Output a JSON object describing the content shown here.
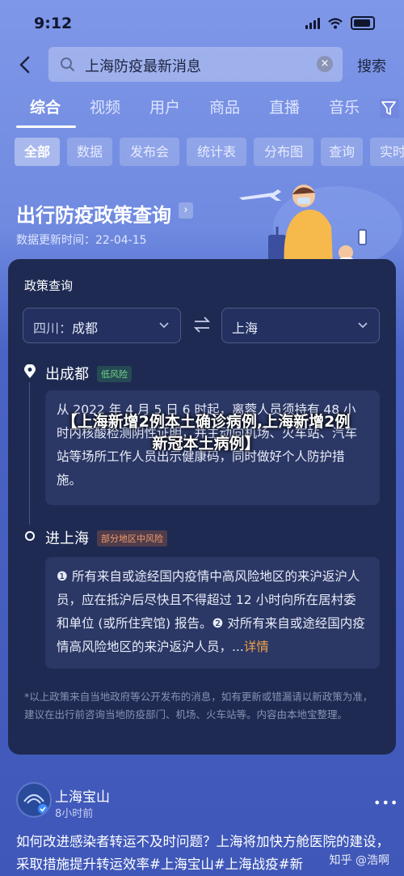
{
  "status_bar": {
    "time": "9:12"
  },
  "search": {
    "query": "上海防疫最新消息",
    "clear_label": "×",
    "button_label": "搜索"
  },
  "tabs": [
    "综合",
    "视频",
    "用户",
    "商品",
    "直播",
    "音乐"
  ],
  "chips": [
    "全部",
    "数据",
    "发布会",
    "统计表",
    "分布图",
    "查询",
    "实时"
  ],
  "banner": {
    "title": "出行防疫政策查询",
    "arrow": "›",
    "updated": "数据更新时间：22-04-15"
  },
  "card": {
    "title": "政策查询",
    "from": {
      "province": "四川：",
      "city": "成都"
    },
    "to": {
      "city": "上海"
    },
    "depart": {
      "title": "出成都",
      "risk": "低风险",
      "text": "从 2022 年 4 月 5 日 6 时起，离蓉人员须持有 48 小时内核酸检测阴性证明，并主动向机场、火车站、汽车站等场所工作人员出示健康码，同时做好个人防护措施。"
    },
    "arrive": {
      "title": "进上海",
      "risk": "部分地区中风险",
      "text": "❶ 所有来自或途经国内疫情中高风险地区的来沪返沪人员，应在抵沪后尽快且不得超过 12 小时向所在居村委和单位 (或所住宾馆) 报告。❷ 对所有来自或途经国内疫情高风险地区的来沪返沪人员，...",
      "more": "详情"
    },
    "note": "*以上政策来自当地政府等公开发布的消息，如有更新或错漏请以新政策为准，建议在出行前咨询当地防疫部门、机场、火车站等。内容由本地宝整理。"
  },
  "overlay_title": "【上海新增2例本土确诊病例,上海新增2例新冠本土病例】",
  "post": {
    "author": "上海宝山",
    "time": "8小时前",
    "menu": "•••",
    "body": "如何改进感染者转运不及时问题？上海将加快方舱医院的建设，采取措施提升转运效率#上海宝山#上海战疫#新"
  },
  "watermark": "知乎 @浩啊",
  "colors": {
    "card": "#1e2a52",
    "accent_orange": "#f0a24a",
    "low_risk": "#6fd38a",
    "mid_risk": "#f39a67"
  }
}
